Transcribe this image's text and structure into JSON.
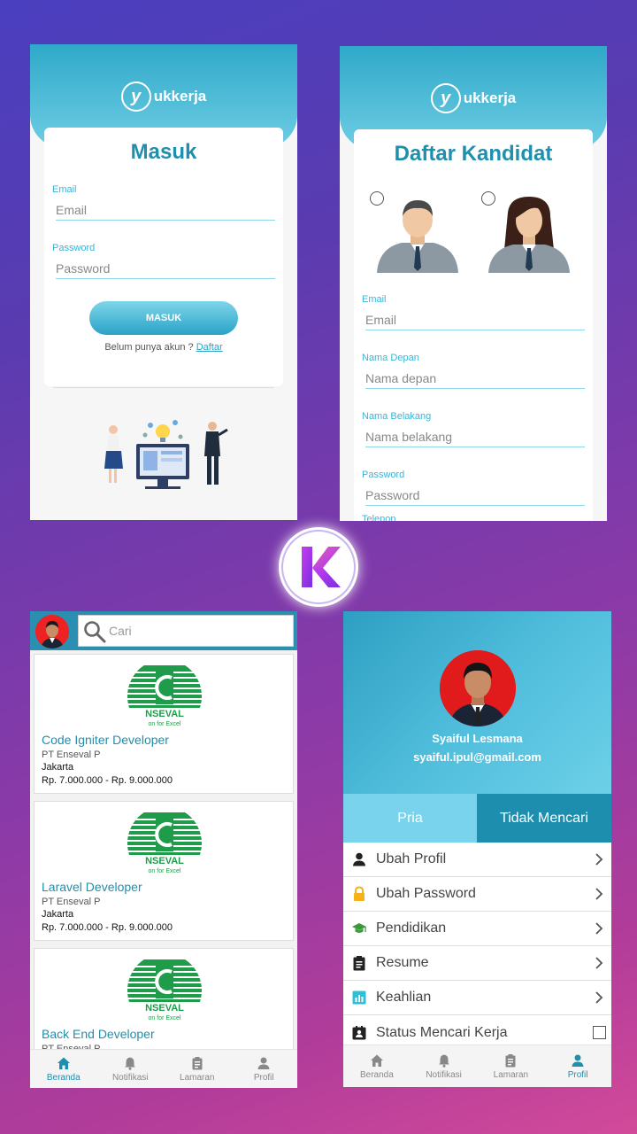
{
  "brand": {
    "logo_text": "ukkerja",
    "logo_mark": "y"
  },
  "login": {
    "title": "Masuk",
    "email_label": "Email",
    "email_placeholder": "Email",
    "password_label": "Password",
    "password_placeholder": "Password",
    "submit_label": "MASUK",
    "register_hint": "Belum punya akun ? ",
    "register_link": "Daftar"
  },
  "register": {
    "title": "Daftar Kandidat",
    "gender_options": [
      "male-avatar",
      "female-avatar"
    ],
    "fields": [
      {
        "label": "Email",
        "placeholder": "Email"
      },
      {
        "label": "Nama Depan",
        "placeholder": "Nama depan"
      },
      {
        "label": "Nama Belakang",
        "placeholder": "Nama belakang"
      },
      {
        "label": "Password",
        "placeholder": "Password"
      },
      {
        "label": "Telepon",
        "placeholder": ""
      }
    ]
  },
  "home": {
    "search_placeholder": "Cari",
    "jobs": [
      {
        "title": "Code Igniter Developer",
        "company": "PT Enseval P",
        "city": "Jakarta",
        "salary": "Rp. 7.000.000 - Rp. 9.000.000"
      },
      {
        "title": "Laravel Developer",
        "company": "PT Enseval P",
        "city": "Jakarta",
        "salary": "Rp. 7.000.000 - Rp. 9.000.000"
      },
      {
        "title": "Back End Developer",
        "company": "PT Enseval P",
        "city": "",
        "salary": ""
      }
    ],
    "company_logo_text": "NSEVAL",
    "company_logo_tagline": "on for Excel"
  },
  "nav": {
    "items": [
      {
        "label": "Beranda",
        "icon": "home-icon"
      },
      {
        "label": "Notifikasi",
        "icon": "bell-icon"
      },
      {
        "label": "Lamaran",
        "icon": "clipboard-icon"
      },
      {
        "label": "Profil",
        "icon": "person-icon"
      }
    ]
  },
  "profile": {
    "name": "Syaiful Lesmana",
    "email": "syaiful.ipul@gmail.com",
    "gender": "Pria",
    "job_status": "Tidak Mencari",
    "menu": [
      {
        "label": "Ubah Profil",
        "icon": "person-icon",
        "color": "#222222"
      },
      {
        "label": "Ubah Password",
        "icon": "lock-icon",
        "color": "#f5b21a"
      },
      {
        "label": "Pendidikan",
        "icon": "graduation-cap-icon",
        "color": "#3a9a3a"
      },
      {
        "label": "Resume",
        "icon": "clipboard-icon",
        "color": "#222222"
      },
      {
        "label": "Keahlian",
        "icon": "chart-icon",
        "color": "#2fbfd6"
      },
      {
        "label": "Status Mencari Kerja",
        "icon": "badge-icon",
        "color": "#222222"
      }
    ]
  },
  "colors": {
    "accent": "#1f8fae",
    "header_light": "#6fcde4",
    "header_dark": "#2fa9c9"
  }
}
